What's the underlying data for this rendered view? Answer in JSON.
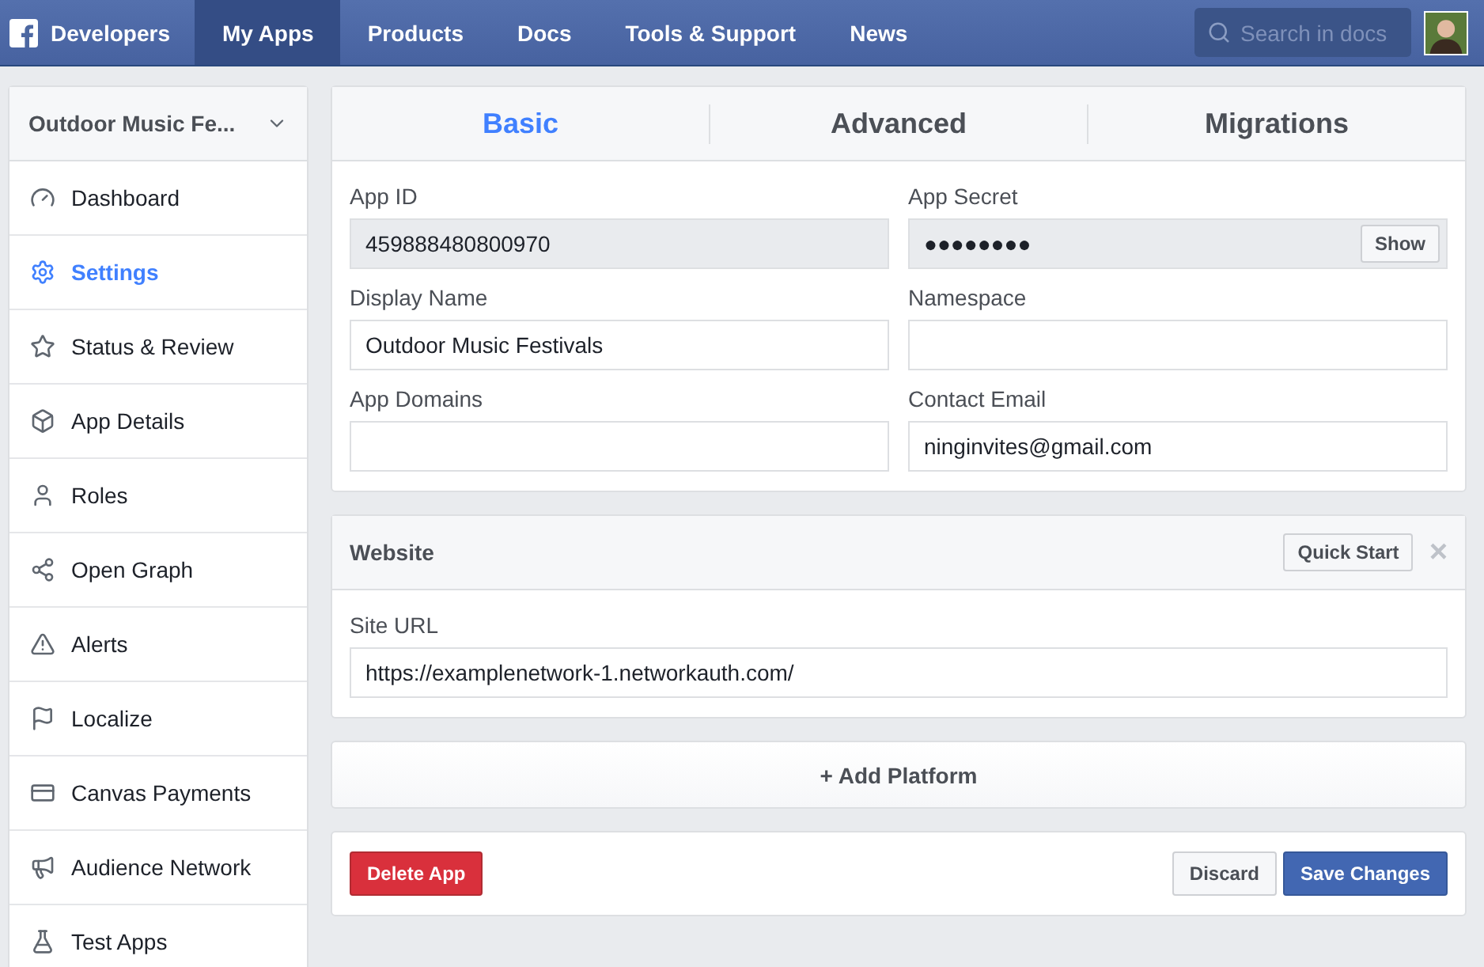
{
  "topbar": {
    "brand": "Developers",
    "nav": [
      {
        "label": "My Apps",
        "selected": true
      },
      {
        "label": "Products",
        "selected": false
      },
      {
        "label": "Docs",
        "selected": false
      },
      {
        "label": "Tools & Support",
        "selected": false
      },
      {
        "label": "News",
        "selected": false
      }
    ],
    "search": {
      "placeholder": "Search in docs"
    }
  },
  "sidebar": {
    "app_name": "Outdoor Music Fe...",
    "items": [
      {
        "label": "Dashboard",
        "kind": "gauge",
        "selected": false
      },
      {
        "label": "Settings",
        "kind": "gear",
        "selected": true
      },
      {
        "label": "Status & Review",
        "kind": "star",
        "selected": false
      },
      {
        "label": "App Details",
        "kind": "box",
        "selected": false
      },
      {
        "label": "Roles",
        "kind": "person",
        "selected": false
      },
      {
        "label": "Open Graph",
        "kind": "graph",
        "selected": false
      },
      {
        "label": "Alerts",
        "kind": "warning",
        "selected": false
      },
      {
        "label": "Localize",
        "kind": "flag",
        "selected": false
      },
      {
        "label": "Canvas Payments",
        "kind": "card",
        "selected": false
      },
      {
        "label": "Audience Network",
        "kind": "megaphone",
        "selected": false
      },
      {
        "label": "Test Apps",
        "kind": "flask",
        "selected": false
      }
    ]
  },
  "tabs": [
    {
      "label": "Basic",
      "selected": true
    },
    {
      "label": "Advanced",
      "selected": false
    },
    {
      "label": "Migrations",
      "selected": false
    }
  ],
  "fields": [
    {
      "label": "App ID",
      "kind": "readonly",
      "value": "459888480800970"
    },
    {
      "label": "App Secret",
      "kind": "secret",
      "value": "●●●●●●●●",
      "button": "Show"
    },
    {
      "label": "Display Name",
      "kind": "text",
      "value": "Outdoor Music Festivals"
    },
    {
      "label": "Namespace",
      "kind": "text"
    },
    {
      "label": "App Domains",
      "kind": "text"
    },
    {
      "label": "Contact Email",
      "kind": "text",
      "value": "ninginvites@gmail.com"
    }
  ],
  "website": {
    "title": "Website",
    "button": "Quick Start",
    "close": "×",
    "field": {
      "label": "Site URL",
      "kind": "text",
      "value": "https://examplenetwork-1.networkauth.com/"
    }
  },
  "add_platform": "+ Add Platform",
  "footer": {
    "delete": "Delete App",
    "discard": "Discard",
    "save": "Save Changes"
  }
}
